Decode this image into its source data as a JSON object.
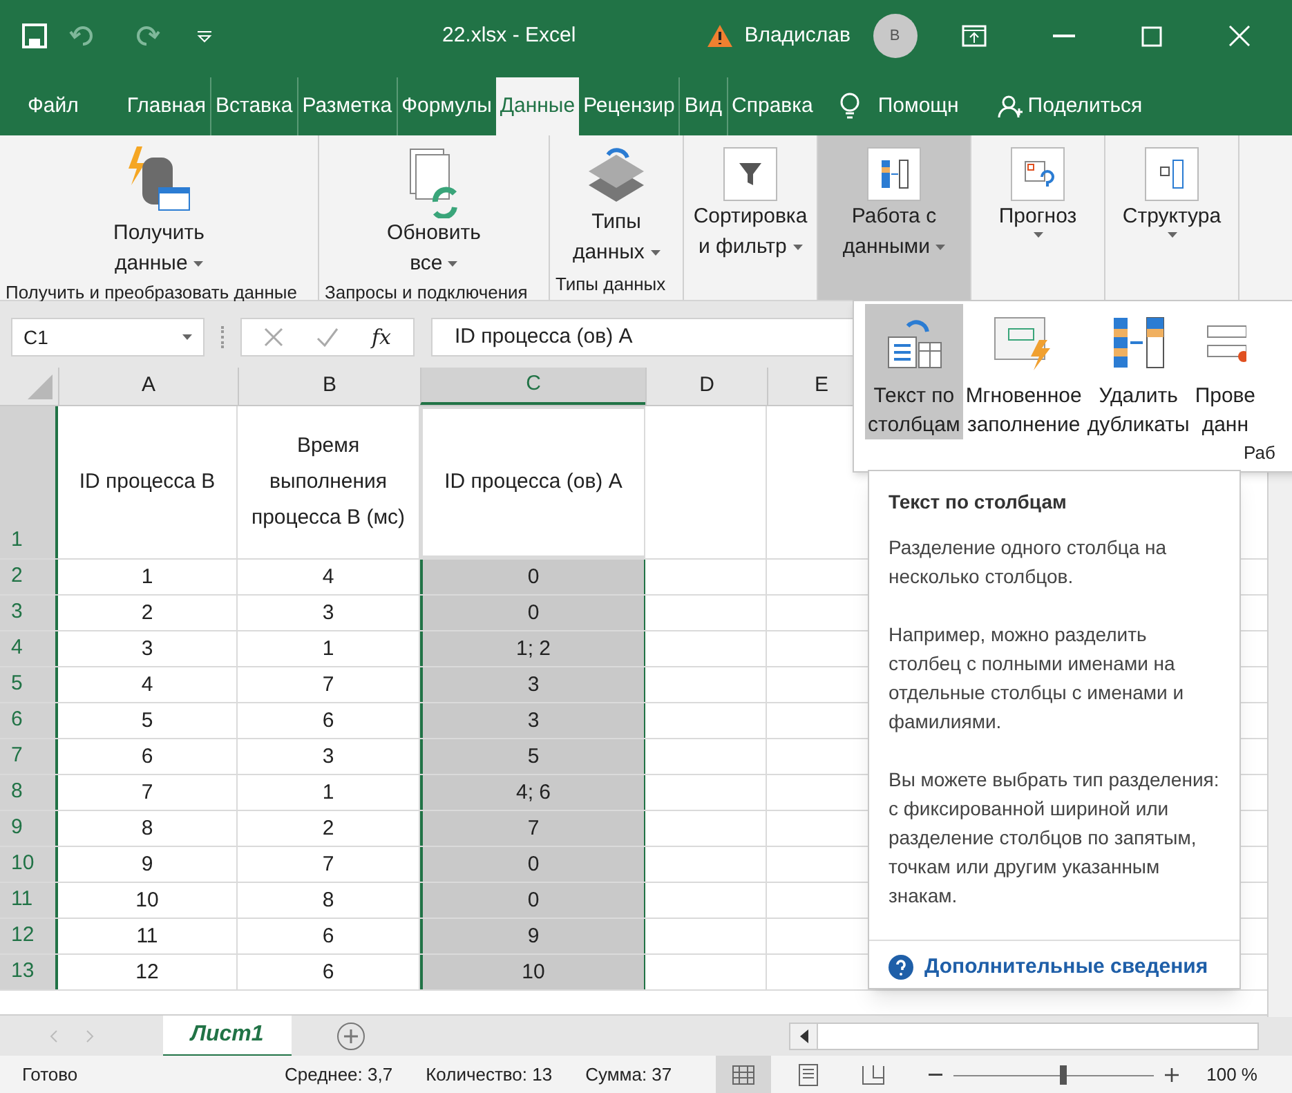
{
  "title_bar": {
    "title": "22.xlsx  -  Excel",
    "user": "Владислав",
    "avatar": "В"
  },
  "menu_tabs": [
    {
      "label": "Файл",
      "selected": false
    },
    {
      "label": "Главная",
      "selected": false
    },
    {
      "label": "Вставка",
      "selected": false
    },
    {
      "label": "Разметка",
      "selected": false
    },
    {
      "label": "Формулы",
      "selected": false
    },
    {
      "label": "Данные",
      "selected": true
    },
    {
      "label": "Рецензир",
      "selected": false
    },
    {
      "label": "Вид",
      "selected": false
    },
    {
      "label": "Справка",
      "selected": false
    }
  ],
  "help": "Помощн",
  "share": "Поделиться",
  "ribbon_groups": [
    {
      "label": "Получить и преобразовать данные",
      "buttons": [
        {
          "kind": "get",
          "lines": [
            "Получить",
            "данные"
          ],
          "pressed": false
        }
      ]
    },
    {
      "label": "Запросы и подключения",
      "buttons": [
        {
          "kind": "refresh",
          "lines": [
            "Обновить",
            "все"
          ],
          "pressed": false
        }
      ]
    },
    {
      "label": "Типы данных",
      "buttons": [
        {
          "kind": "types",
          "lines": [
            "Типы",
            "данных"
          ],
          "pressed": false
        }
      ]
    },
    {
      "buttons": [
        {
          "kind": "filter",
          "lines": [
            "Сортировка",
            "и фильтр"
          ],
          "pressed": false
        }
      ]
    },
    {
      "buttons": [
        {
          "kind": "data",
          "lines": [
            "Работа с",
            "данными"
          ],
          "pressed": true
        }
      ]
    },
    {
      "buttons": [
        {
          "kind": "forecast",
          "lines": [
            "Прогноз"
          ],
          "pressed": false
        }
      ]
    },
    {
      "buttons": [
        {
          "kind": "outline",
          "lines": [
            "Структура"
          ],
          "pressed": false
        }
      ]
    }
  ],
  "name_box": "C1",
  "fx": "fx",
  "formula": "ID процесса (ов) A",
  "columns": [
    {
      "label": "A",
      "selected": false
    },
    {
      "label": "B",
      "selected": false
    },
    {
      "label": "C",
      "selected": true
    },
    {
      "label": "D",
      "selected": false
    },
    {
      "label": "E",
      "selected": false
    }
  ],
  "rows": [
    {
      "number": "1",
      "selected": true,
      "cells": [
        "ID процесса B",
        "Время выполнения процесса B (мс)",
        "ID процесса (ов) A"
      ]
    },
    {
      "number": "2",
      "selected": true,
      "cells": [
        "1",
        "4",
        "0"
      ]
    },
    {
      "number": "3",
      "selected": true,
      "cells": [
        "2",
        "3",
        "0"
      ]
    },
    {
      "number": "4",
      "selected": true,
      "cells": [
        "3",
        "1",
        "1; 2"
      ]
    },
    {
      "number": "5",
      "selected": true,
      "cells": [
        "4",
        "7",
        "3"
      ]
    },
    {
      "number": "6",
      "selected": true,
      "cells": [
        "5",
        "6",
        "3"
      ]
    },
    {
      "number": "7",
      "selected": true,
      "cells": [
        "6",
        "3",
        "5"
      ]
    },
    {
      "number": "8",
      "selected": true,
      "cells": [
        "7",
        "1",
        "4; 6"
      ]
    },
    {
      "number": "9",
      "selected": true,
      "cells": [
        "8",
        "2",
        "7"
      ]
    },
    {
      "number": "10",
      "selected": true,
      "cells": [
        "9",
        "7",
        "0"
      ]
    },
    {
      "number": "11",
      "selected": true,
      "cells": [
        "10",
        "8",
        "0"
      ]
    },
    {
      "number": "12",
      "selected": true,
      "cells": [
        "11",
        "6",
        "9"
      ]
    },
    {
      "number": "13",
      "selected": true,
      "cells": [
        "12",
        "6",
        "10"
      ]
    }
  ],
  "dropdown": {
    "items": [
      {
        "kind": "text",
        "lines": [
          "Текст по",
          "столбцам"
        ],
        "selected": true
      },
      {
        "kind": "flash",
        "lines": [
          "Мгновенное",
          "заполнение"
        ],
        "selected": false
      },
      {
        "kind": "dupes",
        "lines": [
          "Удалить",
          "дубликаты"
        ],
        "selected": false
      },
      {
        "kind": "check",
        "lines": [
          "Прове",
          "данн"
        ],
        "selected": false
      }
    ],
    "group_label": "Раб"
  },
  "tooltip": {
    "title": "Текст по столбцам",
    "paragraphs": [
      "Разделение одного столбца на несколько столбцов.",
      "Например, можно разделить столбец с полными именами на отдельные столбцы с именами и фамилиями.",
      "Вы можете выбрать тип разделения: с фиксированной шириной или разделение столбцов по запятым, точкам или другим указанным знакам."
    ],
    "link": "Дополнительные сведения"
  },
  "sheet_tabs": [
    {
      "label": "Лист1",
      "selected": true
    }
  ],
  "status_bar": {
    "state": "Готово",
    "average": "Среднее: 3,7",
    "count": "Количество: 13",
    "sum": "Сумма: 37",
    "zoom": {
      "level": 0.55
    },
    "zoom_text": "100 %"
  }
}
